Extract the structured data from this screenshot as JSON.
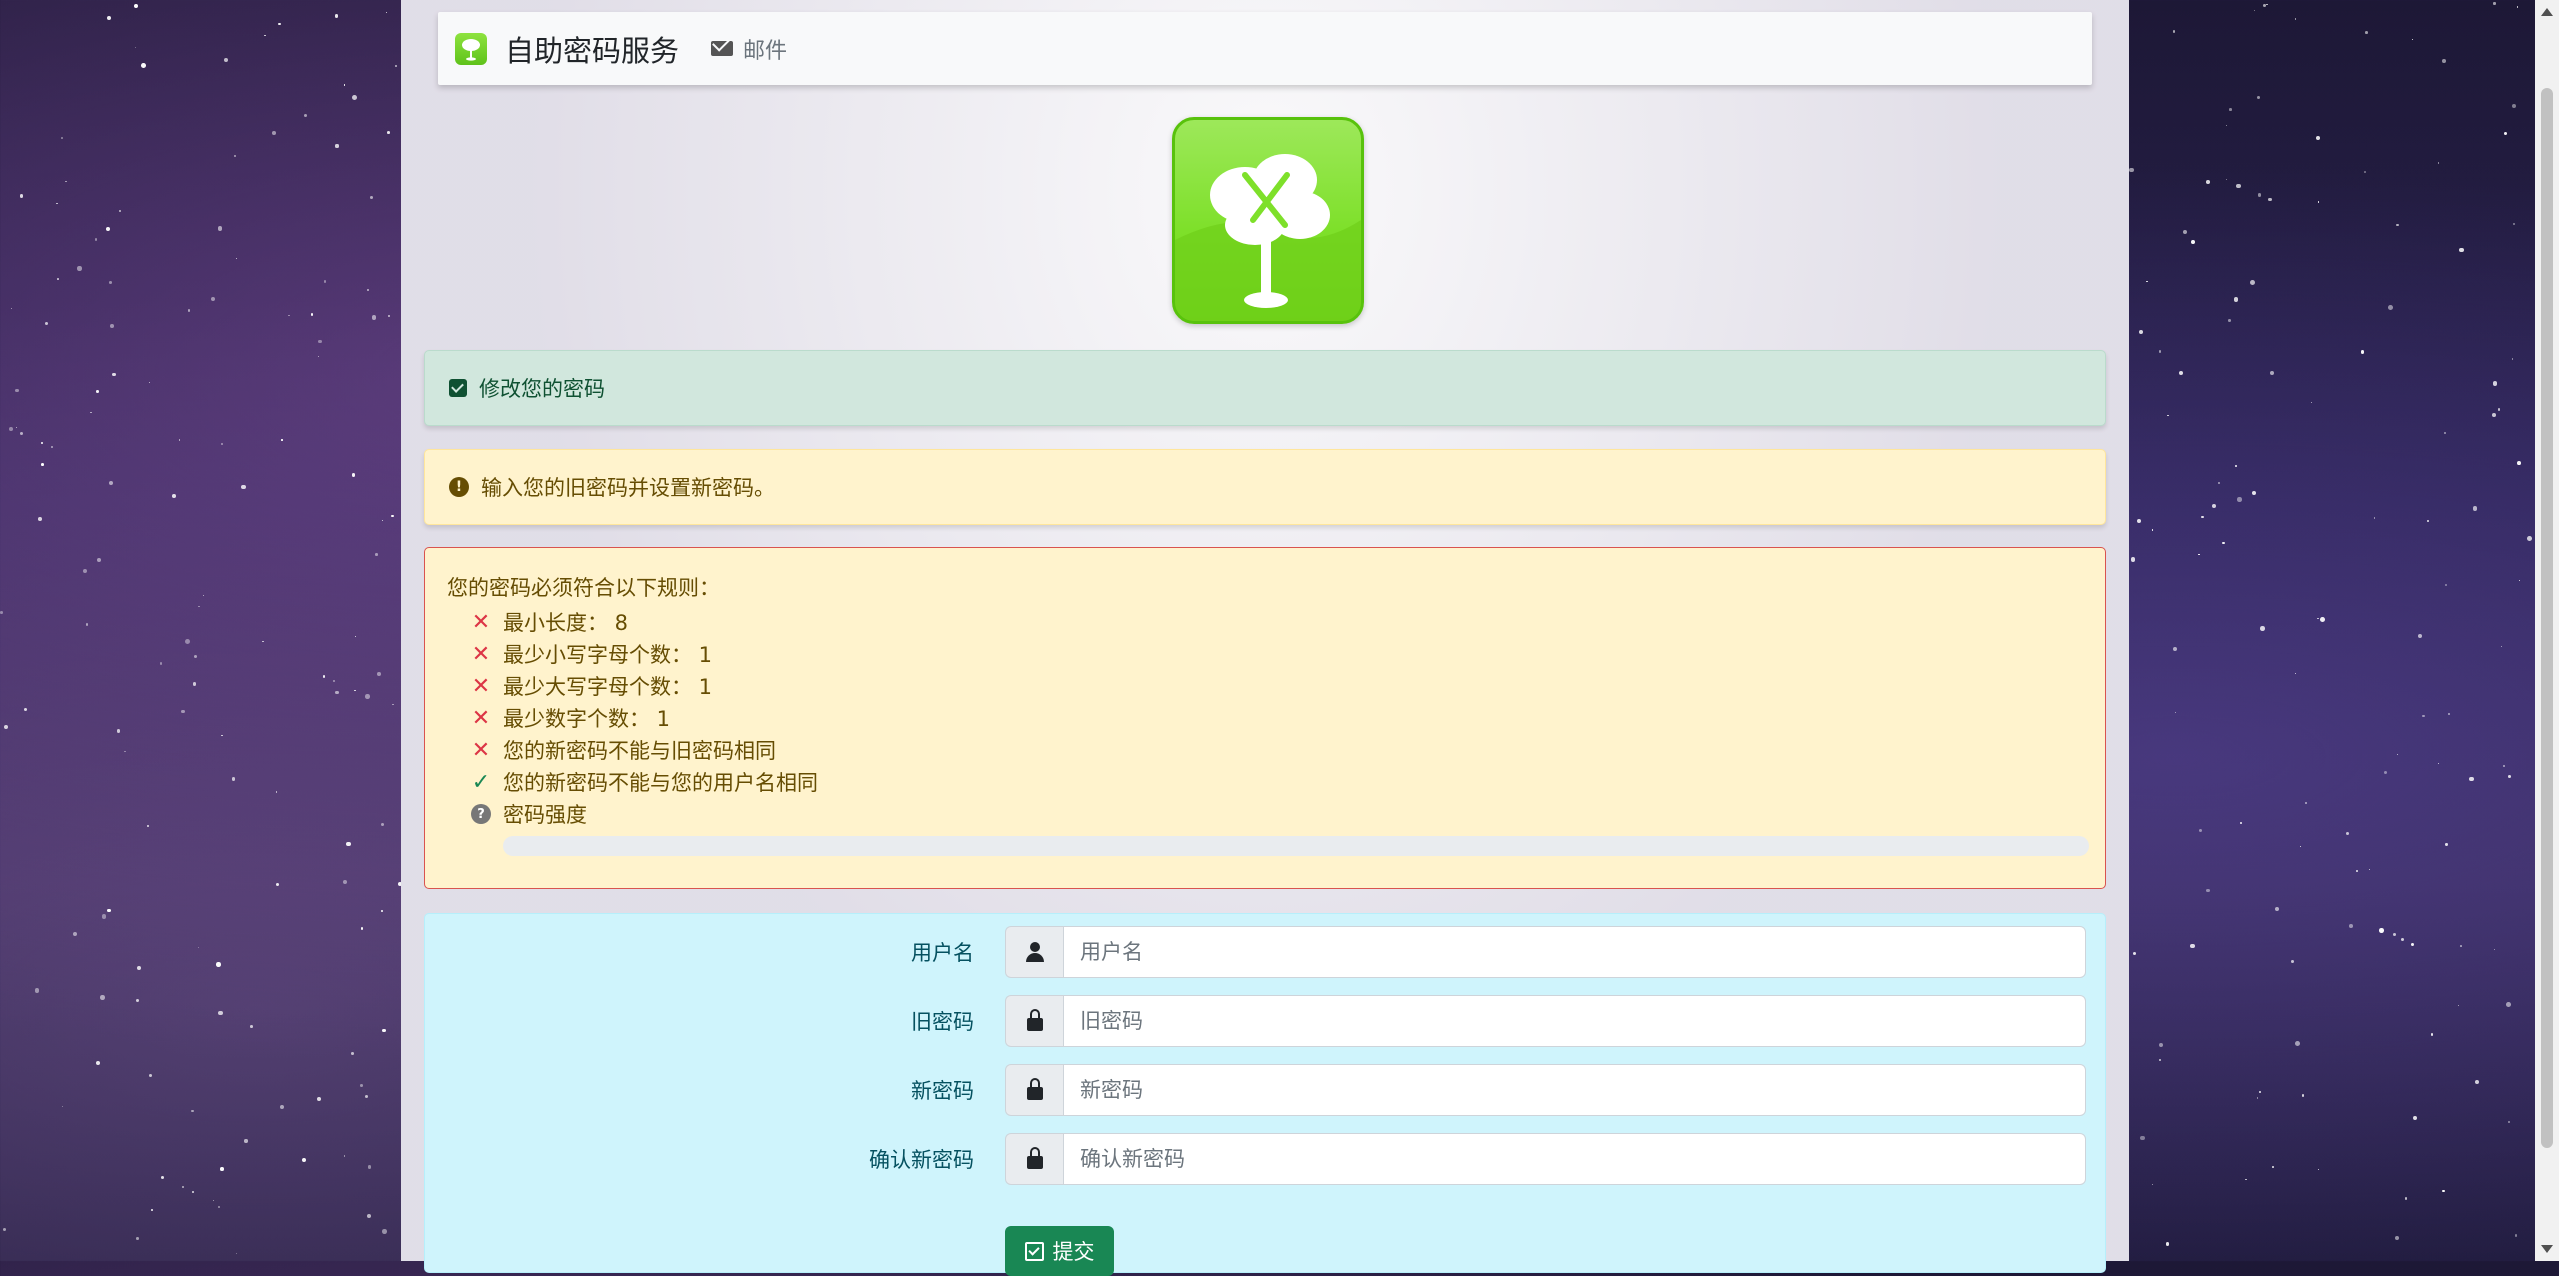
{
  "navbar": {
    "brand": "自助密码服务",
    "mail_label": "邮件"
  },
  "alerts": {
    "success": "修改您的密码",
    "warning": "输入您的旧密码并设置新密码。"
  },
  "rules": {
    "title": "您的密码必须符合以下规则：",
    "items": [
      {
        "text": "最小长度： 8",
        "status": "fail"
      },
      {
        "text": "最少小写字母个数： 1",
        "status": "fail"
      },
      {
        "text": "最少大写字母个数： 1",
        "status": "fail"
      },
      {
        "text": "最少数字个数： 1",
        "status": "fail"
      },
      {
        "text": "您的新密码不能与旧密码相同",
        "status": "fail"
      },
      {
        "text": "您的新密码不能与您的用户名相同",
        "status": "pass"
      },
      {
        "text": "密码强度",
        "status": "unknown"
      }
    ],
    "strength": 0
  },
  "form": {
    "fields": [
      {
        "label": "用户名",
        "placeholder": "用户名",
        "icon": "user-icon"
      },
      {
        "label": "旧密码",
        "placeholder": "旧密码",
        "icon": "lock-icon"
      },
      {
        "label": "新密码",
        "placeholder": "新密码",
        "icon": "lock-icon"
      },
      {
        "label": "确认新密码",
        "placeholder": "确认新密码",
        "icon": "lock-icon"
      }
    ],
    "submit_label": "提交"
  }
}
